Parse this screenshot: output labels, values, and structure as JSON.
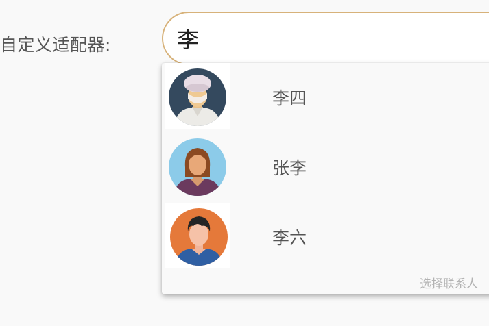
{
  "form": {
    "label": "自定义适配器:",
    "input_value": "李"
  },
  "dropdown": {
    "options": [
      {
        "name": "李四",
        "avatar": "chef-avatar-icon"
      },
      {
        "name": "张李",
        "avatar": "woman-avatar-icon"
      },
      {
        "name": "李六",
        "avatar": "man-avatar-icon"
      }
    ],
    "footer_hint": "选择联系人"
  },
  "colors": {
    "input_border": "#d7b27a",
    "label_text": "#555555",
    "hint_text": "#b3b3b3"
  }
}
